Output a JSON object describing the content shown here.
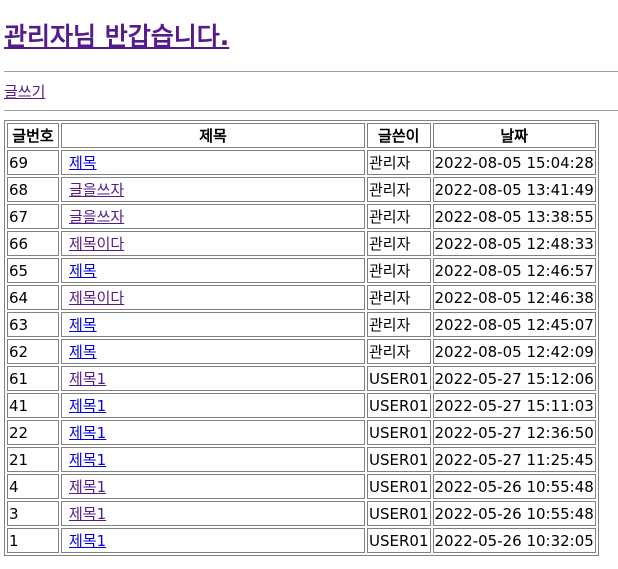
{
  "header": {
    "welcome": "관리자님 반갑습니다."
  },
  "actions": {
    "write_label": "글쓰기"
  },
  "table": {
    "columns": [
      "글번호",
      "제목",
      "글쓴이",
      "날짜"
    ],
    "rows": [
      {
        "no": "69",
        "title": " 제목 ",
        "writer": "관리자",
        "date": "2022-08-05 15:04:28"
      },
      {
        "no": "68",
        "title": " 글을쓰자 ",
        "writer": "관리자",
        "date": "2022-08-05 13:41:49"
      },
      {
        "no": "67",
        "title": " 글을쓰자 ",
        "writer": "관리자",
        "date": "2022-08-05 13:38:55"
      },
      {
        "no": "66",
        "title": " 제목이다 ",
        "writer": "관리자",
        "date": "2022-08-05 12:48:33"
      },
      {
        "no": "65",
        "title": " 제목 ",
        "writer": "관리자",
        "date": "2022-08-05 12:46:57"
      },
      {
        "no": "64",
        "title": " 제목이다 ",
        "writer": "관리자",
        "date": "2022-08-05 12:46:38"
      },
      {
        "no": "63",
        "title": " 제목 ",
        "writer": "관리자",
        "date": "2022-08-05 12:45:07"
      },
      {
        "no": "62",
        "title": " 제목 ",
        "writer": "관리자",
        "date": "2022-08-05 12:42:09"
      },
      {
        "no": "61",
        "title": " 제목1 ",
        "writer": "USER01",
        "date": "2022-05-27 15:12:06"
      },
      {
        "no": "41",
        "title": " 제목1 ",
        "writer": "USER01",
        "date": "2022-05-27 15:11:03"
      },
      {
        "no": "22",
        "title": " 제목1 ",
        "writer": "USER01",
        "date": "2022-05-27 12:36:50"
      },
      {
        "no": "21",
        "title": " 제목1 ",
        "writer": "USER01",
        "date": "2022-05-27 11:25:45"
      },
      {
        "no": "4",
        "title": " 제목1 ",
        "writer": "USER01",
        "date": "2022-05-26 10:55:48"
      },
      {
        "no": "3",
        "title": " 제목1 ",
        "writer": "USER01",
        "date": "2022-05-26 10:55:48"
      },
      {
        "no": "1",
        "title": " 제목1 ",
        "writer": "USER01",
        "date": "2022-05-26 10:32:05"
      }
    ]
  },
  "colors": {
    "visited_link": "#551a8b",
    "unvisited_link": "#0000ee",
    "border": "#808080"
  }
}
